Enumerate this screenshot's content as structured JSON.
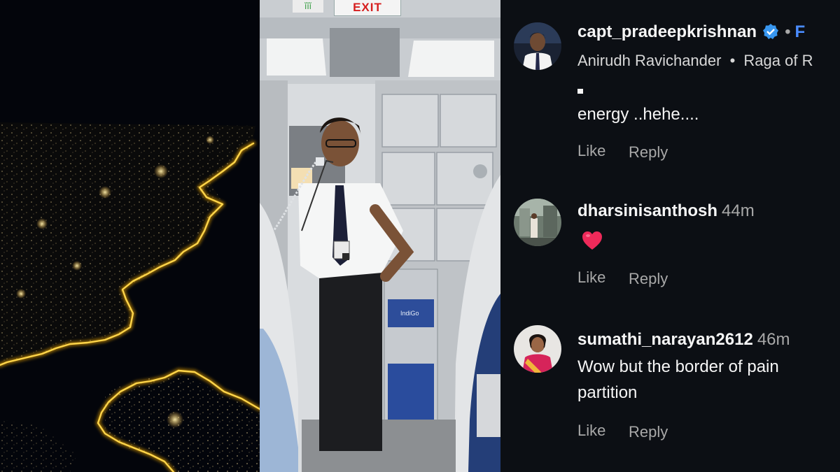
{
  "cabin": {
    "exit_sign": "EXIT",
    "green_sign": "ĭĭĭ",
    "cart_brand": "IndiGo"
  },
  "post": {
    "author": "capt_pradeepkrishnan",
    "follow_label": "F",
    "dot": "•",
    "music_artist": "Anirudh Ravichander",
    "music_title": "Raga of R"
  },
  "comments": [
    {
      "text_line1": "energy ..hehe....",
      "like": "Like",
      "reply": "Reply"
    },
    {
      "username": "dharsinisanthosh",
      "time": "44m",
      "emoji": "heart",
      "like": "Like",
      "reply": "Reply"
    },
    {
      "username": "sumathi_narayan2612",
      "time": "46m",
      "text_line1": "Wow but the border of pain",
      "text_line2": "partition",
      "like": "Like",
      "reply": "Reply"
    }
  ],
  "colors": {
    "panel_bg": "#0c0f14",
    "muted": "#a8a8a8",
    "verified": "#3897f0",
    "heart": "#ee2a5a",
    "coast_glow": "#ffc21f"
  }
}
